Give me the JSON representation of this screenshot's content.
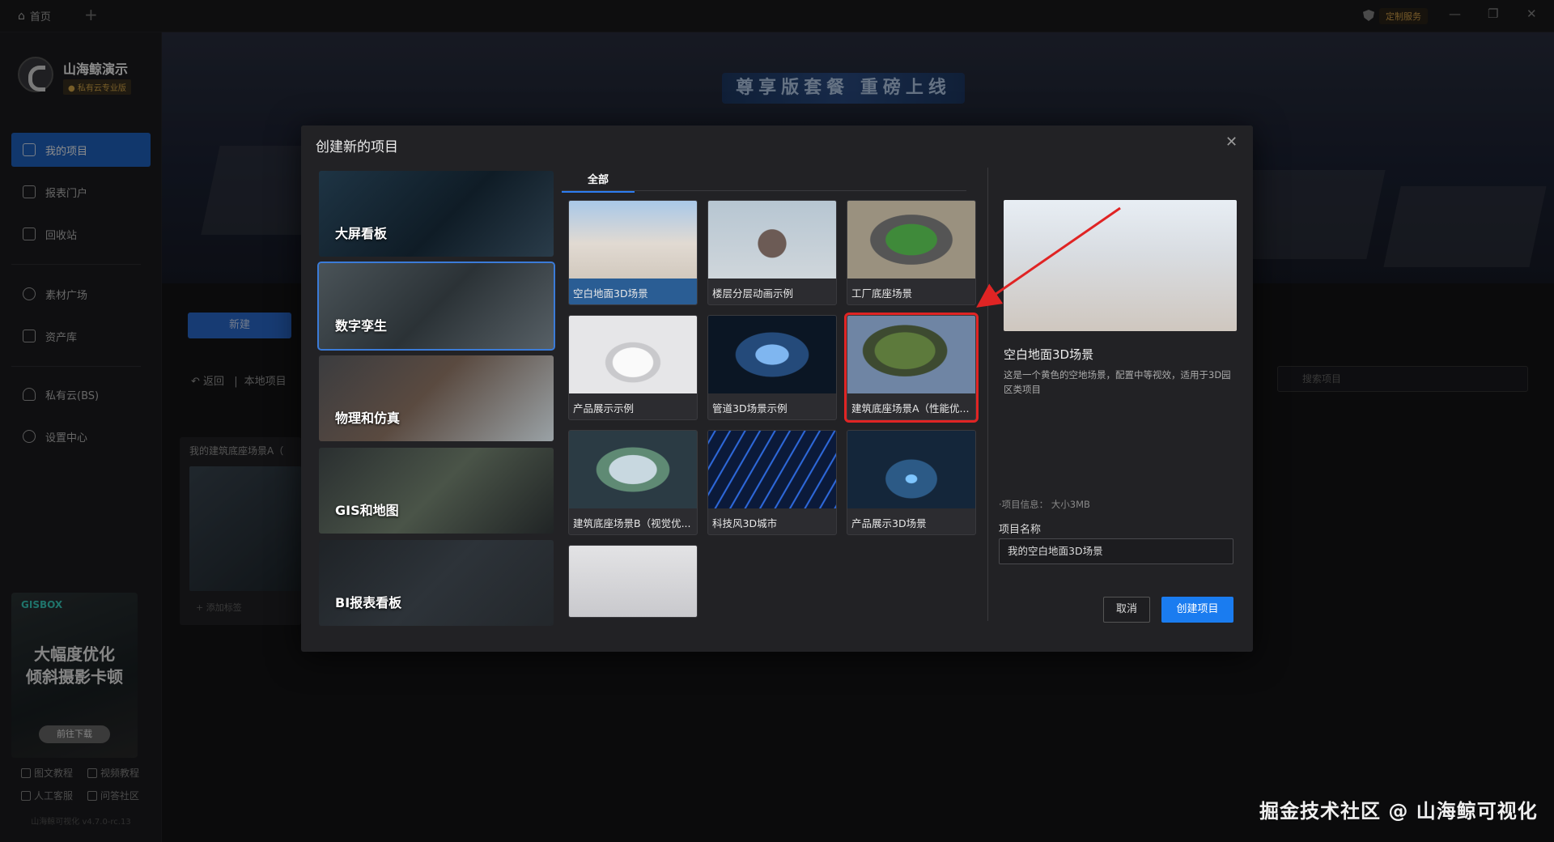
{
  "titlebar": {
    "home_label": "首页",
    "custom_service_label": "定制服务"
  },
  "user": {
    "name": "山海鲸演示",
    "edition": "● 私有云专业版"
  },
  "sidebar": {
    "items": [
      {
        "label": "我的项目"
      },
      {
        "label": "报表门户"
      },
      {
        "label": "回收站"
      },
      {
        "label": "素材广场"
      },
      {
        "label": "资产库"
      },
      {
        "label": "私有云(BS)"
      },
      {
        "label": "设置中心"
      }
    ],
    "promo": {
      "brand": "GISBOX",
      "line1": "大幅度优化",
      "line2": "倾斜摄影卡顿",
      "button": "前往下载"
    },
    "help": {
      "text_tutorial": "图文教程",
      "video_tutorial": "视频教程",
      "support": "人工客服",
      "community": "问答社区"
    },
    "version": "山海鲸可视化 v4.7.0-rc.13"
  },
  "background": {
    "banner_title": "尊享版套餐 重磅上线",
    "new_button": "新建",
    "back_label": "返回",
    "breadcrumb": "本地项目",
    "search_placeholder": "搜索项目",
    "card_title": "我的建筑底座场景A（",
    "card_add_tag": "+ 添加标签"
  },
  "modal": {
    "title": "创建新的项目",
    "categories": [
      {
        "label": "大屏看板"
      },
      {
        "label": "数字孪生"
      },
      {
        "label": "物理和仿真"
      },
      {
        "label": "GIS和地图"
      },
      {
        "label": "BI报表看板"
      }
    ],
    "tab_all": "全部",
    "templates": [
      {
        "label": "空白地面3D场景"
      },
      {
        "label": "楼层分层动画示例"
      },
      {
        "label": "工厂底座场景"
      },
      {
        "label": "产品展示示例"
      },
      {
        "label": "管道3D场景示例"
      },
      {
        "label": "建筑底座场景A（性能优..."
      },
      {
        "label": "建筑底座场景B（视觉优..."
      },
      {
        "label": "科技风3D城市"
      },
      {
        "label": "产品展示3D场景"
      },
      {
        "label": ""
      }
    ],
    "preview": {
      "name": "空白地面3D场景",
      "description": "这是一个黄色的空地场景，配置中等视效，适用于3D园区类项目",
      "info": "·项目信息：  大小3MB",
      "name_label": "项目名称",
      "name_value": "我的空白地面3D场景"
    },
    "cancel_label": "取消",
    "create_label": "创建项目"
  },
  "watermark": "掘金技术社区 @ 山海鲸可视化",
  "colors": {
    "accent": "#1a7cf0",
    "highlight_border": "#e02424",
    "arrow": "#e02424"
  }
}
